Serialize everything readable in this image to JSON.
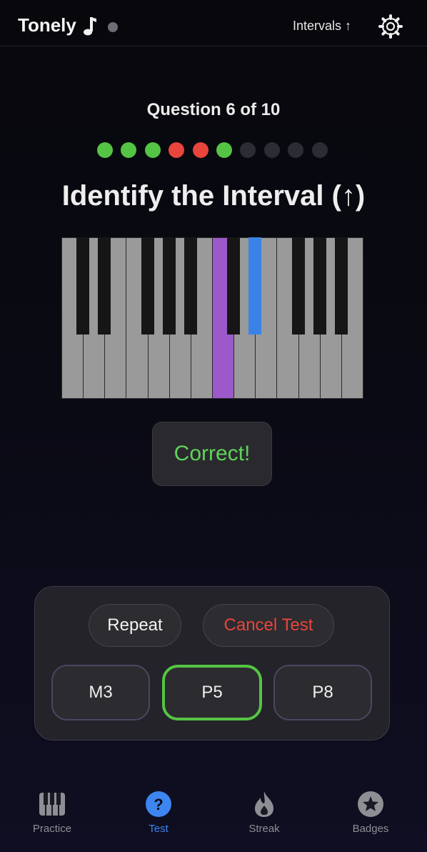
{
  "header": {
    "app_title": "Tonely",
    "mode_label": "Intervals ↑"
  },
  "quiz": {
    "question_label": "Question 6 of 10",
    "progress": [
      "correct",
      "correct",
      "correct",
      "wrong",
      "wrong",
      "correct",
      "pending",
      "pending",
      "pending",
      "pending"
    ],
    "heading": "Identify the Interval (↑)",
    "feedback": "Correct!"
  },
  "piano": {
    "white_keys": 14,
    "highlighted": [
      {
        "key": "white-7",
        "color": "#9b59c9"
      },
      {
        "key": "black-8",
        "color": "#3b82e6"
      }
    ]
  },
  "controls": {
    "repeat_label": "Repeat",
    "cancel_label": "Cancel Test",
    "answers": [
      {
        "label": "M3",
        "state": "default"
      },
      {
        "label": "P5",
        "state": "correct"
      },
      {
        "label": "P8",
        "state": "default"
      }
    ]
  },
  "tabs": [
    {
      "label": "Practice",
      "icon": "piano-icon",
      "active": false
    },
    {
      "label": "Test",
      "icon": "question-circle-icon",
      "active": true
    },
    {
      "label": "Streak",
      "icon": "flame-icon",
      "active": false
    },
    {
      "label": "Badges",
      "icon": "star-badge-icon",
      "active": false
    }
  ],
  "colors": {
    "correct": "#55c444",
    "wrong": "#e8453c",
    "pending": "#2c2c34",
    "accent": "#3d86f0",
    "cancel": "#e8453c"
  }
}
